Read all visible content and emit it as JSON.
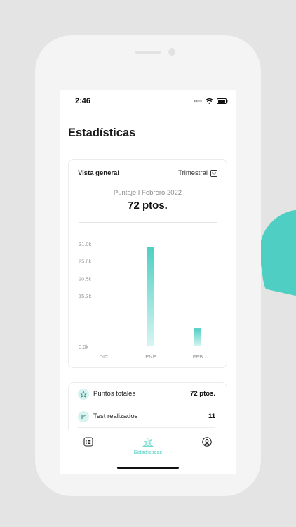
{
  "status_bar": {
    "time": "2:46",
    "icons": [
      "signal-dots-icon",
      "wifi-icon",
      "battery-icon"
    ]
  },
  "page": {
    "title": "Estadísticas"
  },
  "overview_card": {
    "label": "Vista general",
    "period": {
      "selected": "Trimestral",
      "icon": "chevron-down-icon"
    },
    "score_label": "Puntaje I Febrero 2022",
    "score_value": "72 ptos."
  },
  "chart_data": {
    "type": "bar",
    "categories": [
      "DIC",
      "ENE",
      "FEB"
    ],
    "values": [
      0,
      30000,
      5500
    ],
    "y_ticks": [
      "31.0k",
      "25.8k",
      "20.5k",
      "15.3k",
      "0.0k"
    ],
    "y_tick_values": [
      31000,
      25800,
      20500,
      15300,
      0
    ],
    "ylim": [
      0,
      31000
    ],
    "grid": false,
    "colors": {
      "bar_top": "#4fcfc3",
      "bar_bottom": "#d7f5f2"
    }
  },
  "stats": [
    {
      "icon": "star-icon",
      "label": "Puntos totales",
      "value": "72 ptos."
    },
    {
      "icon": "list-lines-icon",
      "label": "Test realizados",
      "value": "11"
    }
  ],
  "tab_bar": {
    "tabs": [
      {
        "icon": "list-icon",
        "label": ""
      },
      {
        "icon": "bar-chart-icon",
        "label": "Estadísticas",
        "active": true
      },
      {
        "icon": "profile-icon",
        "label": ""
      }
    ]
  },
  "colors": {
    "accent": "#4fcfc3"
  }
}
